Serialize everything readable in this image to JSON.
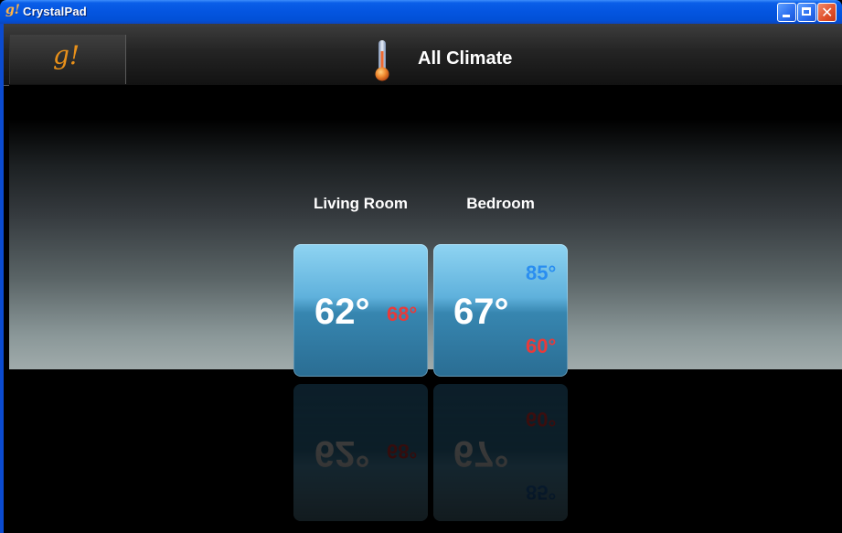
{
  "window": {
    "title": "CrystalPad",
    "logo_glyph": "g!"
  },
  "header": {
    "logo": "g!",
    "icon": "thermometer-icon",
    "title": "All Climate"
  },
  "zones": [
    {
      "name": "Living Room",
      "current": "62°",
      "heat_setpoint": "68°"
    },
    {
      "name": "Bedroom",
      "current": "67°",
      "cool_setpoint": "85°",
      "heat_setpoint": "60°"
    }
  ],
  "colors": {
    "heat": "#e83a3a",
    "cool": "#2a8ef0",
    "accent": "#e8901a"
  }
}
